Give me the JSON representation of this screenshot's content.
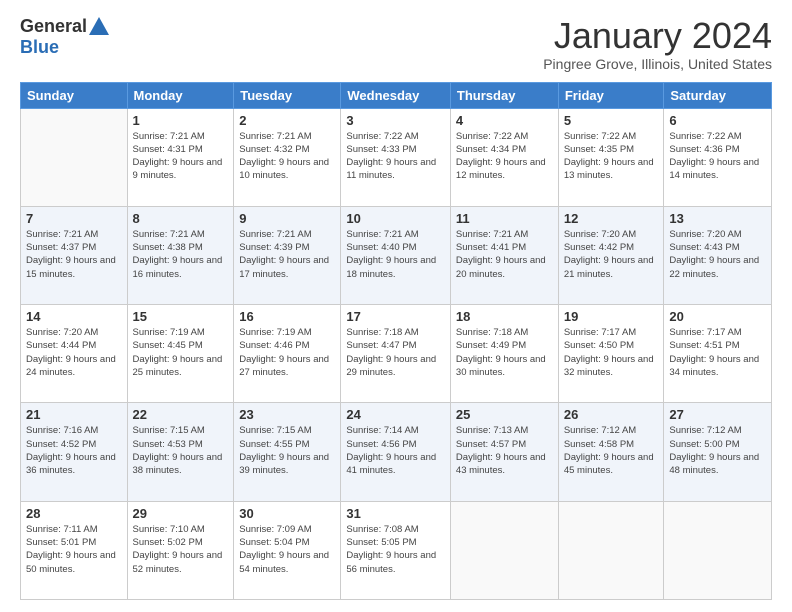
{
  "logo": {
    "general": "General",
    "blue": "Blue"
  },
  "title": "January 2024",
  "location": "Pingree Grove, Illinois, United States",
  "days_of_week": [
    "Sunday",
    "Monday",
    "Tuesday",
    "Wednesday",
    "Thursday",
    "Friday",
    "Saturday"
  ],
  "weeks": [
    [
      {
        "day": "",
        "sunrise": "",
        "sunset": "",
        "daylight": ""
      },
      {
        "day": "1",
        "sunrise": "Sunrise: 7:21 AM",
        "sunset": "Sunset: 4:31 PM",
        "daylight": "Daylight: 9 hours and 9 minutes."
      },
      {
        "day": "2",
        "sunrise": "Sunrise: 7:21 AM",
        "sunset": "Sunset: 4:32 PM",
        "daylight": "Daylight: 9 hours and 10 minutes."
      },
      {
        "day": "3",
        "sunrise": "Sunrise: 7:22 AM",
        "sunset": "Sunset: 4:33 PM",
        "daylight": "Daylight: 9 hours and 11 minutes."
      },
      {
        "day": "4",
        "sunrise": "Sunrise: 7:22 AM",
        "sunset": "Sunset: 4:34 PM",
        "daylight": "Daylight: 9 hours and 12 minutes."
      },
      {
        "day": "5",
        "sunrise": "Sunrise: 7:22 AM",
        "sunset": "Sunset: 4:35 PM",
        "daylight": "Daylight: 9 hours and 13 minutes."
      },
      {
        "day": "6",
        "sunrise": "Sunrise: 7:22 AM",
        "sunset": "Sunset: 4:36 PM",
        "daylight": "Daylight: 9 hours and 14 minutes."
      }
    ],
    [
      {
        "day": "7",
        "sunrise": "Sunrise: 7:21 AM",
        "sunset": "Sunset: 4:37 PM",
        "daylight": "Daylight: 9 hours and 15 minutes."
      },
      {
        "day": "8",
        "sunrise": "Sunrise: 7:21 AM",
        "sunset": "Sunset: 4:38 PM",
        "daylight": "Daylight: 9 hours and 16 minutes."
      },
      {
        "day": "9",
        "sunrise": "Sunrise: 7:21 AM",
        "sunset": "Sunset: 4:39 PM",
        "daylight": "Daylight: 9 hours and 17 minutes."
      },
      {
        "day": "10",
        "sunrise": "Sunrise: 7:21 AM",
        "sunset": "Sunset: 4:40 PM",
        "daylight": "Daylight: 9 hours and 18 minutes."
      },
      {
        "day": "11",
        "sunrise": "Sunrise: 7:21 AM",
        "sunset": "Sunset: 4:41 PM",
        "daylight": "Daylight: 9 hours and 20 minutes."
      },
      {
        "day": "12",
        "sunrise": "Sunrise: 7:20 AM",
        "sunset": "Sunset: 4:42 PM",
        "daylight": "Daylight: 9 hours and 21 minutes."
      },
      {
        "day": "13",
        "sunrise": "Sunrise: 7:20 AM",
        "sunset": "Sunset: 4:43 PM",
        "daylight": "Daylight: 9 hours and 22 minutes."
      }
    ],
    [
      {
        "day": "14",
        "sunrise": "Sunrise: 7:20 AM",
        "sunset": "Sunset: 4:44 PM",
        "daylight": "Daylight: 9 hours and 24 minutes."
      },
      {
        "day": "15",
        "sunrise": "Sunrise: 7:19 AM",
        "sunset": "Sunset: 4:45 PM",
        "daylight": "Daylight: 9 hours and 25 minutes."
      },
      {
        "day": "16",
        "sunrise": "Sunrise: 7:19 AM",
        "sunset": "Sunset: 4:46 PM",
        "daylight": "Daylight: 9 hours and 27 minutes."
      },
      {
        "day": "17",
        "sunrise": "Sunrise: 7:18 AM",
        "sunset": "Sunset: 4:47 PM",
        "daylight": "Daylight: 9 hours and 29 minutes."
      },
      {
        "day": "18",
        "sunrise": "Sunrise: 7:18 AM",
        "sunset": "Sunset: 4:49 PM",
        "daylight": "Daylight: 9 hours and 30 minutes."
      },
      {
        "day": "19",
        "sunrise": "Sunrise: 7:17 AM",
        "sunset": "Sunset: 4:50 PM",
        "daylight": "Daylight: 9 hours and 32 minutes."
      },
      {
        "day": "20",
        "sunrise": "Sunrise: 7:17 AM",
        "sunset": "Sunset: 4:51 PM",
        "daylight": "Daylight: 9 hours and 34 minutes."
      }
    ],
    [
      {
        "day": "21",
        "sunrise": "Sunrise: 7:16 AM",
        "sunset": "Sunset: 4:52 PM",
        "daylight": "Daylight: 9 hours and 36 minutes."
      },
      {
        "day": "22",
        "sunrise": "Sunrise: 7:15 AM",
        "sunset": "Sunset: 4:53 PM",
        "daylight": "Daylight: 9 hours and 38 minutes."
      },
      {
        "day": "23",
        "sunrise": "Sunrise: 7:15 AM",
        "sunset": "Sunset: 4:55 PM",
        "daylight": "Daylight: 9 hours and 39 minutes."
      },
      {
        "day": "24",
        "sunrise": "Sunrise: 7:14 AM",
        "sunset": "Sunset: 4:56 PM",
        "daylight": "Daylight: 9 hours and 41 minutes."
      },
      {
        "day": "25",
        "sunrise": "Sunrise: 7:13 AM",
        "sunset": "Sunset: 4:57 PM",
        "daylight": "Daylight: 9 hours and 43 minutes."
      },
      {
        "day": "26",
        "sunrise": "Sunrise: 7:12 AM",
        "sunset": "Sunset: 4:58 PM",
        "daylight": "Daylight: 9 hours and 45 minutes."
      },
      {
        "day": "27",
        "sunrise": "Sunrise: 7:12 AM",
        "sunset": "Sunset: 5:00 PM",
        "daylight": "Daylight: 9 hours and 48 minutes."
      }
    ],
    [
      {
        "day": "28",
        "sunrise": "Sunrise: 7:11 AM",
        "sunset": "Sunset: 5:01 PM",
        "daylight": "Daylight: 9 hours and 50 minutes."
      },
      {
        "day": "29",
        "sunrise": "Sunrise: 7:10 AM",
        "sunset": "Sunset: 5:02 PM",
        "daylight": "Daylight: 9 hours and 52 minutes."
      },
      {
        "day": "30",
        "sunrise": "Sunrise: 7:09 AM",
        "sunset": "Sunset: 5:04 PM",
        "daylight": "Daylight: 9 hours and 54 minutes."
      },
      {
        "day": "31",
        "sunrise": "Sunrise: 7:08 AM",
        "sunset": "Sunset: 5:05 PM",
        "daylight": "Daylight: 9 hours and 56 minutes."
      },
      {
        "day": "",
        "sunrise": "",
        "sunset": "",
        "daylight": ""
      },
      {
        "day": "",
        "sunrise": "",
        "sunset": "",
        "daylight": ""
      },
      {
        "day": "",
        "sunrise": "",
        "sunset": "",
        "daylight": ""
      }
    ]
  ]
}
